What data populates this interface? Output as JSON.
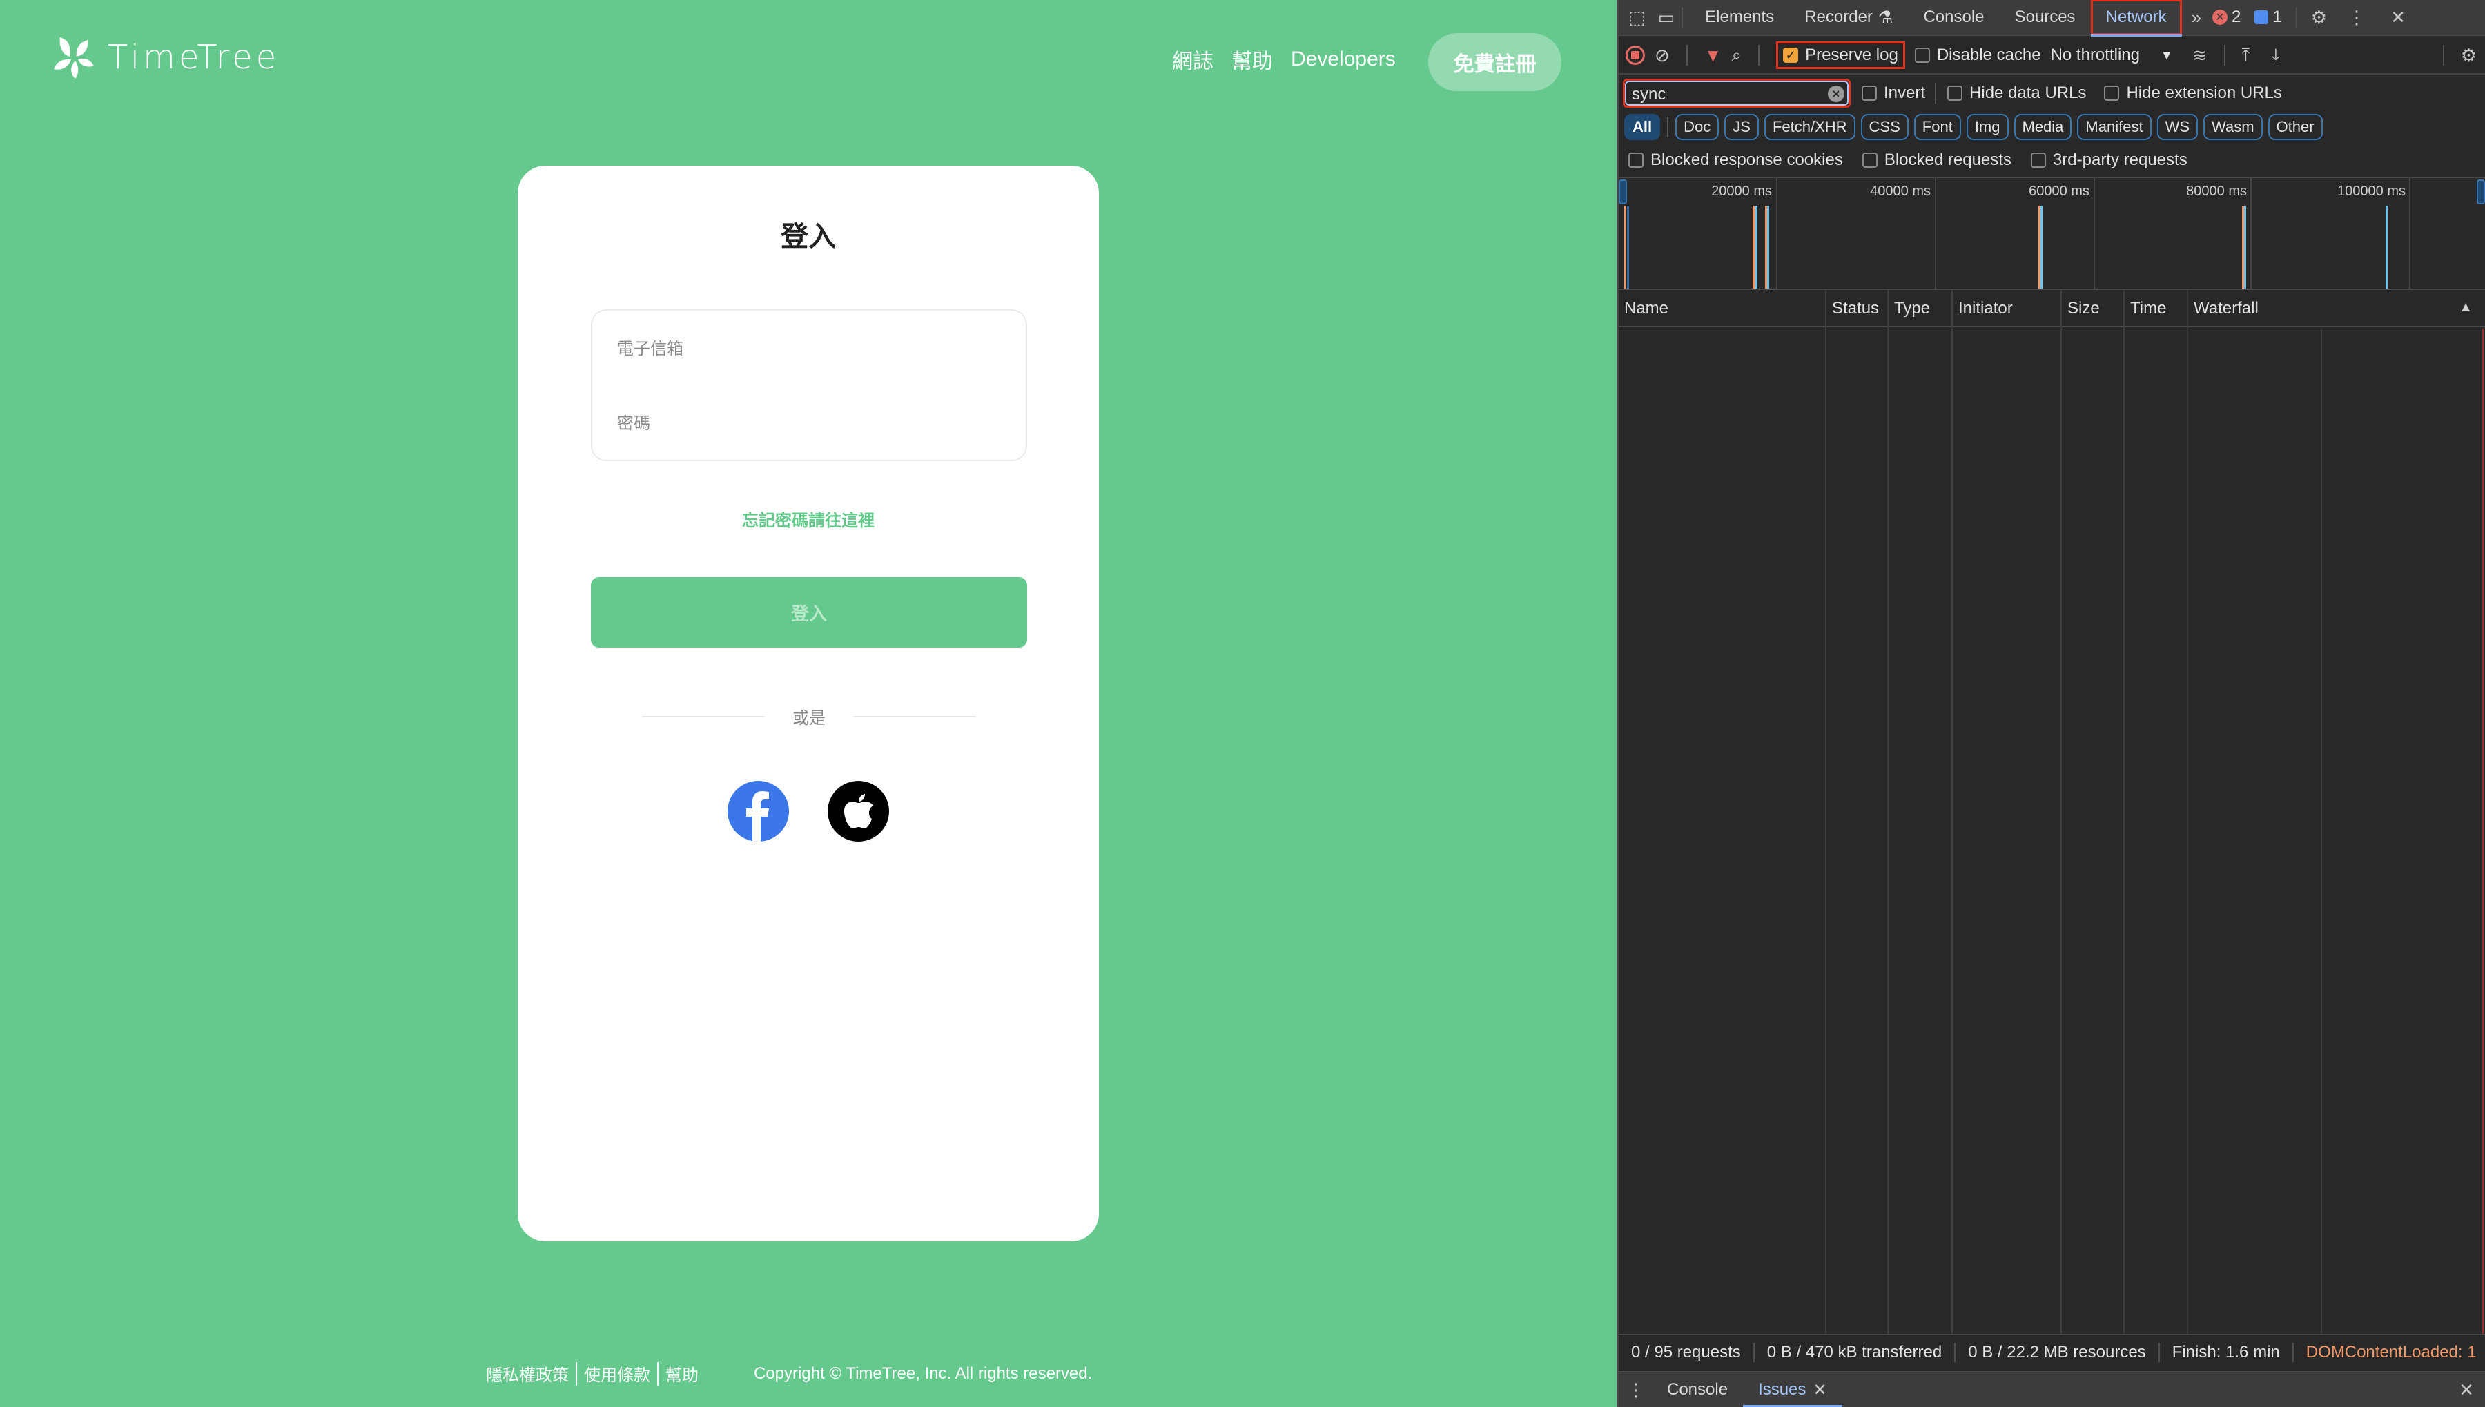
{
  "page": {
    "logo_text": "TimeTree",
    "nav": [
      "網誌",
      "幫助",
      "Developers"
    ],
    "register_label": "免費註冊",
    "login": {
      "title": "登入",
      "email_placeholder": "電子信箱",
      "password_placeholder": "密碼",
      "forgot_link": "忘記密碼請往這裡",
      "submit_label": "登入",
      "or_text": "或是",
      "social": [
        "facebook",
        "apple"
      ]
    },
    "footer": {
      "links": [
        "隱私權政策",
        "使用條款",
        "幫助"
      ],
      "copyright": "Copyright © TimeTree, Inc. All rights reserved."
    },
    "colors": {
      "brand_green": "#65c98d",
      "facebook_blue": "#3b77e8"
    }
  },
  "devtools": {
    "tabs": [
      "Elements",
      "Recorder",
      "Console",
      "Sources",
      "Network"
    ],
    "active_tab": "Network",
    "error_count": "2",
    "message_count": "1",
    "toolbar": {
      "preserve_log": "Preserve log",
      "preserve_log_checked": true,
      "disable_cache": "Disable cache",
      "throttling": "No throttling"
    },
    "filter": {
      "value": "sync",
      "invert": "Invert",
      "hide_data_urls": "Hide data URLs",
      "hide_extension_urls": "Hide extension URLs"
    },
    "types": [
      "All",
      "Doc",
      "JS",
      "Fetch/XHR",
      "CSS",
      "Font",
      "Img",
      "Media",
      "Manifest",
      "WS",
      "Wasm",
      "Other"
    ],
    "active_type": "All",
    "blocked": [
      "Blocked response cookies",
      "Blocked requests",
      "3rd-party requests"
    ],
    "overview_ticks": [
      "20000 ms",
      "40000 ms",
      "60000 ms",
      "80000 ms",
      "100000 ms"
    ],
    "columns": [
      "Name",
      "Status",
      "Type",
      "Initiator",
      "Size",
      "Time",
      "Waterfall"
    ],
    "status": {
      "requests": "0 / 95 requests",
      "transferred": "0 B / 470 kB transferred",
      "resources": "0 B / 22.2 MB resources",
      "finish": "Finish: 1.6 min",
      "dcl": "DOMContentLoaded: 1"
    },
    "drawer_tabs": [
      "Console",
      "Issues"
    ],
    "drawer_active": "Issues"
  }
}
